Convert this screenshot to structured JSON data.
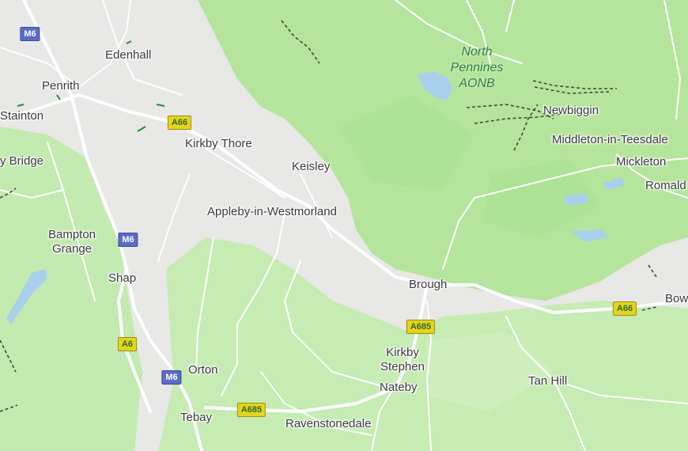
{
  "map": {
    "colors": {
      "land": "#e8e8e6",
      "upland": "#b3e59a",
      "park": "#c7ecb4",
      "water": "#a8d0ec",
      "road": "#ffffff",
      "path": "#3d4a3d",
      "label": "#3a3a3a",
      "aonb_label": "#2f7d4a",
      "motorway_shield": "#5b6cc7",
      "primary_shield": "#e4d41c"
    },
    "places": {
      "edenhall": "Edenhall",
      "penrith": "Penrith",
      "stainton": "Stainton",
      "bridge": "y Bridge",
      "kirkby_thore": "Kirkby Thore",
      "keisley": "Keisley",
      "appleby": "Appleby-in-Westmorland",
      "bampton_grange_1": "Bampton",
      "bampton_grange_2": "Grange",
      "shap": "Shap",
      "orton": "Orton",
      "tebay": "Tebay",
      "ravenstonedale": "Ravenstonedale",
      "brough": "Brough",
      "kirkby_stephen_1": "Kirkby",
      "kirkby_stephen_2": "Stephen",
      "nateby": "Nateby",
      "tan_hill": "Tan Hill",
      "newbiggin": "Newbiggin",
      "middleton": "Middleton-in-Teesdale",
      "mickleton": "Mickleton",
      "romaldkirk": "Romald",
      "bowes": "Bow"
    },
    "aonb": {
      "line1": "North",
      "line2": "Pennines",
      "line3": "AONB"
    },
    "shields": {
      "m6_top": "M6",
      "m6_mid": "M6",
      "m6_low": "M6",
      "a66_penrith": "A66",
      "a66_east": "A66",
      "a6": "A6",
      "a685_stephen": "A685",
      "a685_tebay": "A685"
    }
  }
}
